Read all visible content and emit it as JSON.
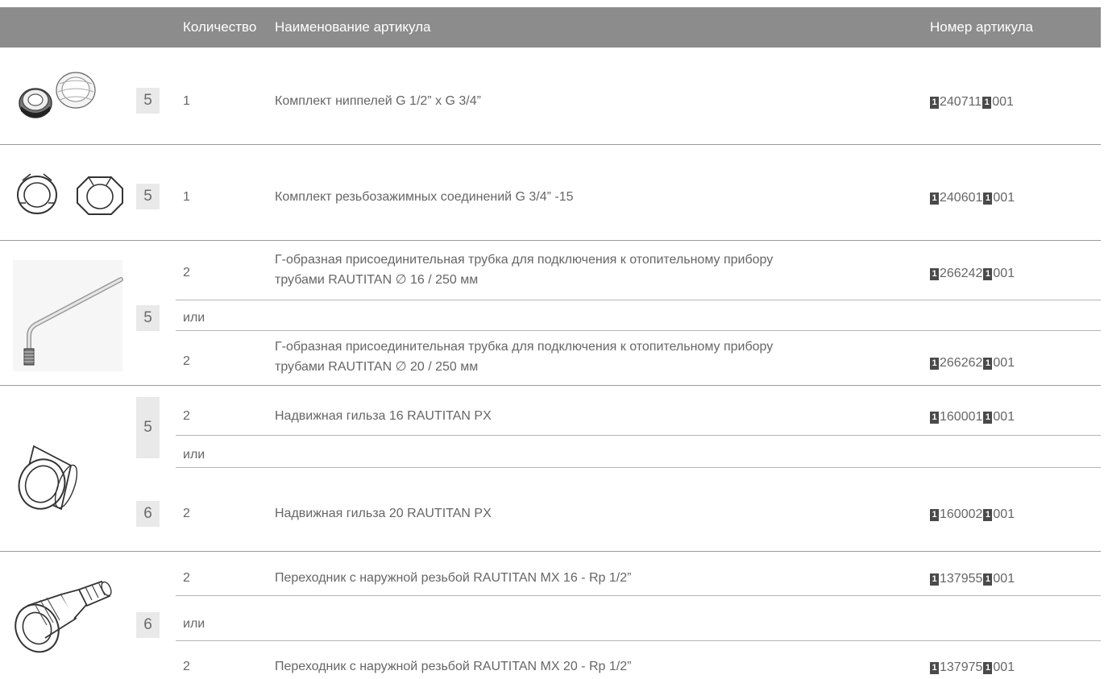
{
  "header": {
    "quantity": "Количество",
    "name": "Наименование артикула",
    "article": "Номер артикула"
  },
  "marker_glyph": "1",
  "rows": [
    {
      "step": "5",
      "qty": "1",
      "name": "Комплект ниппелей G 1/2” x G 3/4”",
      "art_a": "240711",
      "art_b": "001",
      "icon": "nipple-set-icon"
    },
    {
      "step": "5",
      "qty": "1",
      "name": "Комплект резьбозажимных соединений G 3/4” -15",
      "art_a": "240601",
      "art_b": "001",
      "icon": "compression-fitting-set-icon"
    },
    {
      "step": "5",
      "qty": "2",
      "name_l1": "Г-образная присоединительная трубка для подключения к отопительному прибору",
      "name_l2": "трубами RAUTITAN ∅ 16 / 250 мм",
      "art_a": "266242",
      "art_b": "001",
      "icon": "l-shaped-pipe-icon"
    },
    {
      "or": "или"
    },
    {
      "qty": "2",
      "name_l1": "Г-образная присоединительная трубка для подключения к отопительному прибору",
      "name_l2": "трубами RAUTITAN ∅ 20 / 250 мм",
      "art_a": "266262",
      "art_b": "001"
    },
    {
      "step": "5",
      "qty": "2",
      "name": "Надвижная гильза 16 RAUTITAN PX",
      "art_a": "160001",
      "art_b": "001",
      "icon": "sleeve-icon"
    },
    {
      "or": "или"
    },
    {
      "step": "6",
      "qty": "2",
      "name": "Надвижная гильза 20 RAUTITAN PX",
      "art_a": "160002",
      "art_b": "001"
    },
    {
      "step": "6",
      "qty": "2",
      "name": "Переходник с наружной резьбой RAUTITAN MX 16 - Rp 1/2”",
      "art_a": "137955",
      "art_b": "001",
      "icon": "male-thread-adapter-icon"
    },
    {
      "or": "или"
    },
    {
      "qty": "2",
      "name": "Переходник с наружной резьбой RAUTITAN MX 20 - Rp 1/2”",
      "art_a": "137975",
      "art_b": "001"
    }
  ]
}
